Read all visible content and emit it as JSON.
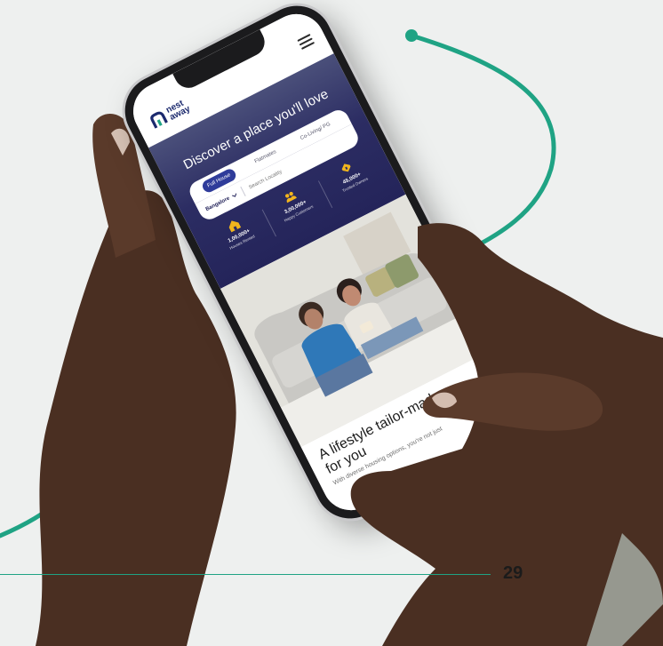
{
  "page_number": "29",
  "app": {
    "logo_text": "nest\naway",
    "menu_icon": "hamburger-menu-icon"
  },
  "hero": {
    "title": "Discover a place you'll love",
    "tabs": [
      {
        "label": "Full House",
        "active": true
      },
      {
        "label": "Flatmates",
        "active": false
      },
      {
        "label": "Co-Living/ PG",
        "active": false
      }
    ],
    "search": {
      "city": "Bangalore",
      "placeholder": "Search Locality"
    },
    "stats": [
      {
        "icon": "house-icon",
        "value": "1,00,000+",
        "label": "Houses Rented"
      },
      {
        "icon": "happy-customers-icon",
        "value": "3,00,000+",
        "label": "Happy Customers"
      },
      {
        "icon": "owners-icon",
        "value": "45,000+",
        "label": "Trusted Owners"
      }
    ]
  },
  "promo": {
    "title": "A lifestyle tailor-made for you",
    "text": "With diverse housing options, you're not just"
  },
  "colors": {
    "accent_green": "#1fa384",
    "hero_navy": "#2c2d63",
    "active_tab": "#2f3c9a",
    "icon_yellow": "#f2b51d"
  }
}
